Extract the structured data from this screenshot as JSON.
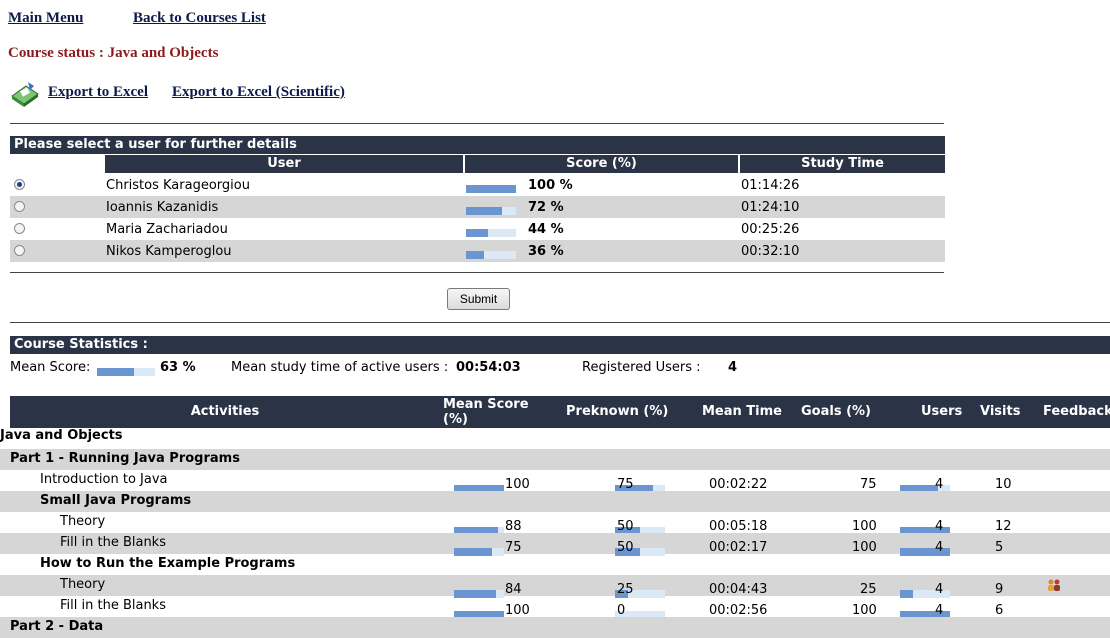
{
  "nav": {
    "main_menu": "Main Menu",
    "back": "Back to Courses List"
  },
  "course_status": "Course status : Java and Objects",
  "export": {
    "excel": "Export to Excel",
    "excel_sci": "Export to Excel (Scientific)",
    "icon": "excel-export-icon"
  },
  "users_table": {
    "title": "Please select a user for further details",
    "headers": [
      "User",
      "Score (%)",
      "Study Time"
    ],
    "rows": [
      {
        "name": "Christos Karageorgiou",
        "score": 100,
        "score_label": "100 %",
        "time": "01:14:26",
        "selected": true
      },
      {
        "name": "Ioannis Kazanidis",
        "score": 72,
        "score_label": "72 %",
        "time": "01:24:10",
        "selected": false
      },
      {
        "name": "Maria Zachariadou",
        "score": 44,
        "score_label": "44 %",
        "time": "00:25:26",
        "selected": false
      },
      {
        "name": "Nikos Kamperoglou",
        "score": 36,
        "score_label": "36 %",
        "time": "00:32:10",
        "selected": false
      }
    ],
    "submit": "Submit"
  },
  "stats": {
    "title": "Course Statistics :",
    "mean_score_label": "Mean Score:",
    "mean_score": 63,
    "mean_score_text": "63 %",
    "mean_time_label": "Mean study time of active users :",
    "mean_time": "00:54:03",
    "registered_label": "Registered Users :",
    "registered": "4"
  },
  "activities": {
    "headers": {
      "activities": "Activities",
      "mean_score_1": "Mean Score",
      "mean_score_2": "(%)",
      "preknown": "Preknown (%)",
      "mean_time": "Mean Time",
      "goals": "Goals (%)",
      "users": "Users",
      "visits": "Visits",
      "feedback": "Feedback"
    },
    "rows": [
      {
        "label": "Java and Objects",
        "indent": 0,
        "bold": true,
        "header": true
      },
      {
        "label": "Part 1 - Running Java Programs",
        "indent": 1,
        "bold": true,
        "grey": true,
        "header": true
      },
      {
        "label": "Introduction to Java",
        "indent": 2,
        "bold": false,
        "mean": 100,
        "mean_text": "100",
        "pre": 75,
        "pre_text": "75",
        "time": "00:02:22",
        "goals": 75,
        "goals_text": "75",
        "users": "4",
        "visits": "10"
      },
      {
        "label": "Small Java Programs",
        "indent": 2,
        "bold": true,
        "grey": true,
        "header": true
      },
      {
        "label": "Theory",
        "indent": 3,
        "bold": false,
        "mean": 88,
        "mean_text": "88",
        "pre": 50,
        "pre_text": "50",
        "time": "00:05:18",
        "goals": 100,
        "goals_text": "100",
        "users": "4",
        "visits": "12"
      },
      {
        "label": "Fill in the Blanks",
        "indent": 3,
        "bold": false,
        "grey": true,
        "mean": 75,
        "mean_text": "75",
        "pre": 50,
        "pre_text": "50",
        "time": "00:02:17",
        "goals": 100,
        "goals_text": "100",
        "users": "4",
        "visits": "5"
      },
      {
        "label": "How to Run the Example Programs",
        "indent": 2,
        "bold": true,
        "header": true
      },
      {
        "label": "Theory",
        "indent": 3,
        "bold": false,
        "grey": true,
        "mean": 84,
        "mean_text": "84",
        "pre": 25,
        "pre_text": "25",
        "time": "00:04:43",
        "goals": 25,
        "goals_text": "25",
        "users": "4",
        "visits": "9",
        "feedback": true
      },
      {
        "label": "Fill in the Blanks",
        "indent": 3,
        "bold": false,
        "mean": 100,
        "mean_text": "100",
        "pre": 0,
        "pre_text": "0",
        "time": "00:02:56",
        "goals": 100,
        "goals_text": "100",
        "users": "4",
        "visits": "6"
      },
      {
        "label": "Part 2 - Data",
        "indent": 1,
        "bold": true,
        "grey": true,
        "header": true
      }
    ]
  },
  "colors": {
    "header_bg": "#2b3346",
    "bar_fill": "#6a95d1",
    "bar_bg": "#dbe9f7",
    "row_grey": "#d6d6d6",
    "status_red": "#8b1a1a"
  }
}
